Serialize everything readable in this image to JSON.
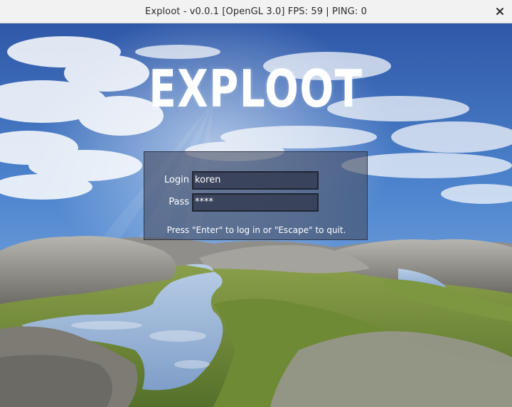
{
  "window": {
    "title": "Exploot - v0.0.1 [OpenGL 3.0] FPS: 59 | PING: 0",
    "close_glyph": "✕"
  },
  "game": {
    "logo": "EXPLOOT"
  },
  "login_form": {
    "login_label": "Login",
    "login_value": "koren",
    "pass_label": "Pass",
    "pass_value": "****",
    "hint": "Press \"Enter\" to log in or \"Escape\" to quit."
  },
  "colors": {
    "sky": "#3a6cc0",
    "water": "#9fb7d8",
    "grass": "#6d8a3a",
    "rock": "#8c8c8c",
    "panel": "#464e64"
  }
}
